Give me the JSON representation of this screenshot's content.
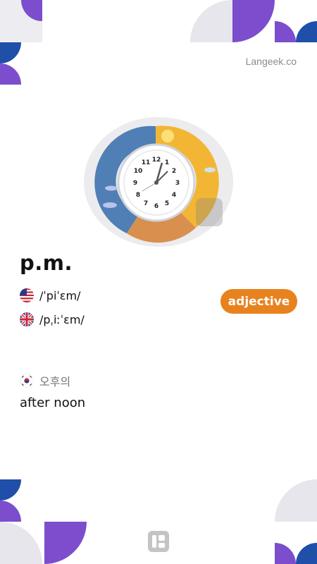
{
  "site_label": "Langeek.co",
  "entry": {
    "word": "p.m.",
    "part_of_speech": "adjective",
    "pronunciations": [
      {
        "accent": "us-flag-icon",
        "ipa": "/ˈpiˈɛm/"
      },
      {
        "accent": "uk-flag-icon",
        "ipa": "/pˌiːˈɛm/"
      }
    ],
    "translation": {
      "language": "korean-flag-icon",
      "text": "오후의"
    },
    "definition": "after noon"
  },
  "colors": {
    "purple": "#7c4dcc",
    "blue": "#1f4fa8",
    "gray": "#e6e6ec",
    "orange": "#e8821e",
    "clock_blue": "#4f7fb5",
    "clock_yellow": "#f3b634"
  },
  "illustration": {
    "icon": "clock-illustration",
    "watermark": "Langeek"
  }
}
